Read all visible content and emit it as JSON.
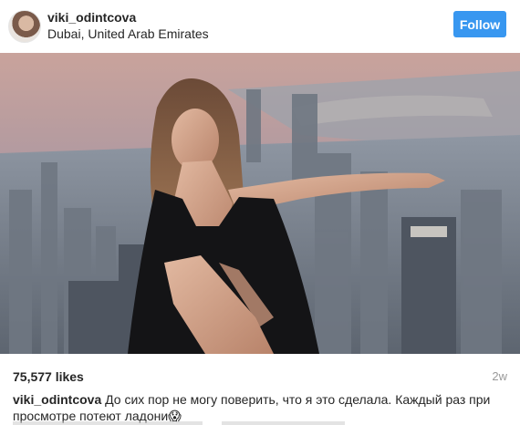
{
  "post": {
    "username": "viki_odintcova",
    "location": "Dubai, United Arab Emirates",
    "follow_label": "Follow",
    "likes": "75,577 likes",
    "time": "2w",
    "caption_user": "viki_odintcova",
    "caption_text": "До сих пор не могу поверить, что я это сделала. Каждый раз при просмотре потеют ладони",
    "caption_emoji": "😱"
  },
  "colors": {
    "follow_button": "#3897f0",
    "text": "#262626",
    "muted": "#999999"
  },
  "icons": {
    "caption_emoji": "scream-face-icon"
  }
}
